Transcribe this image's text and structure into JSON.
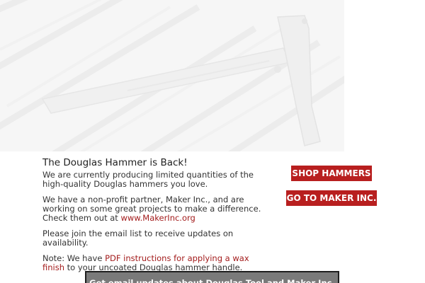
{
  "headline": "The Douglas Hammer is Back!",
  "intro": "We are currently producing limited quantities of the high-quality Douglas hammers you love.",
  "partner": {
    "text": "We have a non-profit partner, Maker Inc., and are working on some great projects to make a difference. Check them out at ",
    "link_label": "www.MakerInc.org"
  },
  "email_note": "Please join the email list to receive updates on availability.",
  "note": {
    "prefix": "Note: We have ",
    "link_label": "PDF instructions for applying a wax finish",
    "suffix": " to your uncoated Douglas hammer handle."
  },
  "buttons": {
    "shop": "SHOP HAMMERS",
    "maker": "GO TO MAKER INC."
  },
  "email_bar": {
    "label": "Get email updates about Douglas Tool and Maker Inc."
  },
  "colors": {
    "accent": "#b81f1f",
    "link": "#a31c1c",
    "email_bar": "#7a7a7a"
  },
  "icons": {
    "hero": "hammer-photo"
  }
}
